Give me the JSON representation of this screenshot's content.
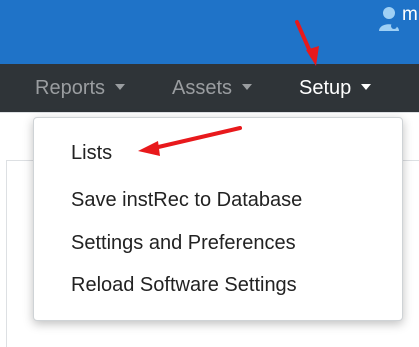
{
  "user": {
    "initial": "m"
  },
  "nav": {
    "items": [
      {
        "label": "Reports",
        "active": false
      },
      {
        "label": "Assets",
        "active": false
      },
      {
        "label": "Setup",
        "active": true
      }
    ]
  },
  "dropdown": {
    "items": [
      {
        "label": "Lists"
      },
      {
        "label": "Save instRec to Database"
      },
      {
        "label": "Settings and Preferences"
      },
      {
        "label": "Reload Software Settings"
      }
    ]
  },
  "colors": {
    "topbar": "#1f73c8",
    "navbar": "#2f3438",
    "annotation_arrow": "#e8191c"
  }
}
